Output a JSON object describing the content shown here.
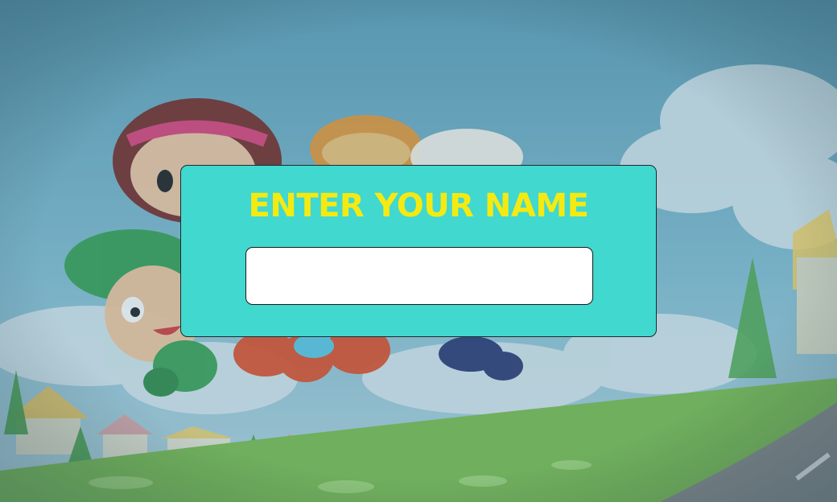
{
  "dialog": {
    "title": "ENTER YOUR NAME",
    "name_input_value": "",
    "name_input_placeholder": ""
  },
  "colors": {
    "dialog_background": "#41d8cf",
    "title_text": "#f4ea12",
    "sky": "#6aa9c0",
    "grass": "#7dbe55"
  },
  "background": {
    "scene": "cartoon-characters-town-sky",
    "characters": [
      "girl-red-hair-headband",
      "boy-green-hat",
      "mushroom-kid",
      "white-hat-kid"
    ]
  }
}
